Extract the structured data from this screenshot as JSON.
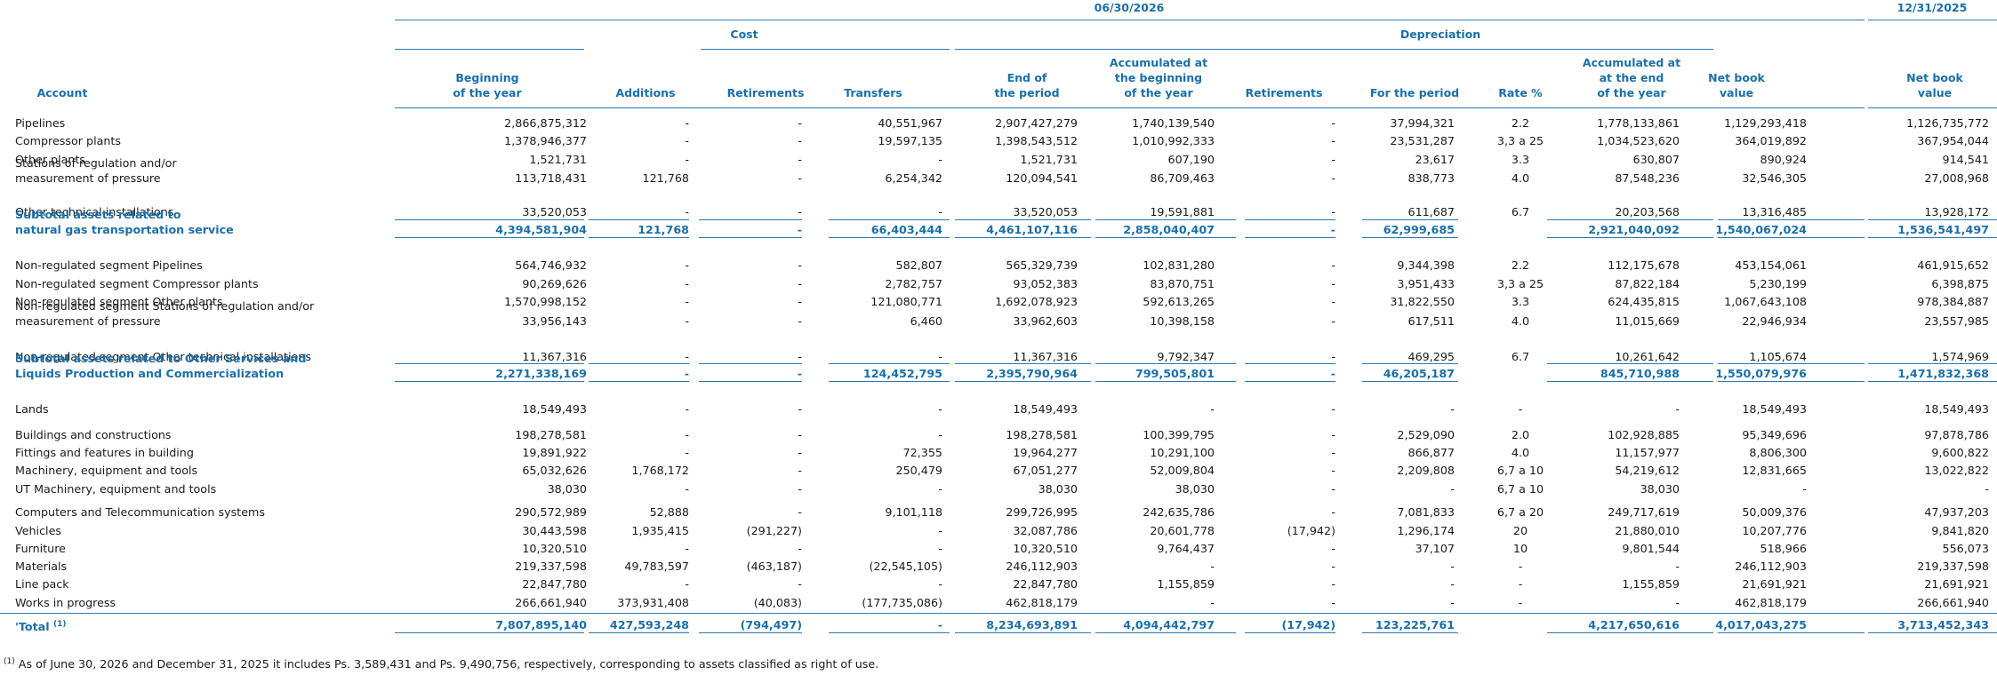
{
  "headers": {
    "date_current": "06/30/2026",
    "date_prior": "12/31/2025",
    "group_cost": "Cost",
    "group_depreciation": "Depreciation",
    "col_account": "Account",
    "cols": [
      [
        "Beginning",
        "of the year"
      ],
      [
        "Additions"
      ],
      [
        "Retirements"
      ],
      [
        "Transfers"
      ],
      [
        "End of",
        "the period"
      ],
      [
        "Accumulated at",
        "the beginning",
        "of the year"
      ],
      [
        "Retirements"
      ],
      [
        "For the period"
      ],
      [
        "Rate %"
      ],
      [
        "Accumulated at",
        "at the end",
        "of the year"
      ],
      [
        "Net book",
        "value"
      ],
      [
        "Net book",
        "value"
      ]
    ]
  },
  "rows": [
    {
      "label": [
        "Pipelines"
      ],
      "v": [
        "2,866,875,312",
        "-",
        "-",
        "40,551,967",
        "2,907,427,279",
        "1,740,139,540",
        "-",
        "37,994,321",
        "2.2",
        "1,778,133,861",
        "1,129,293,418",
        "1,126,735,772"
      ]
    },
    {
      "label": [
        "Compressor plants"
      ],
      "v": [
        "1,378,946,377",
        "-",
        "-",
        "19,597,135",
        "1,398,543,512",
        "1,010,992,333",
        "-",
        "23,531,287",
        "3,3 a 25",
        "1,034,523,620",
        "364,019,892",
        "367,954,044"
      ]
    },
    {
      "label": [
        "Other plants"
      ],
      "v": [
        "1,521,731",
        "-",
        "-",
        "-",
        "1,521,731",
        "607,190",
        "-",
        "23,617",
        "3.3",
        "630,807",
        "890,924",
        "914,541"
      ]
    },
    {
      "label": [
        "Stations of regulation and/or",
        "measurement of pressure"
      ],
      "v": [
        "113,718,431",
        "121,768",
        "-",
        "6,254,342",
        "120,094,541",
        "86,709,463",
        "-",
        "838,773",
        "4.0",
        "87,548,236",
        "32,546,305",
        "27,008,968"
      ]
    },
    {
      "label": [
        "Other technical installations"
      ],
      "v": [
        "33,520,053",
        "-",
        "-",
        "-",
        "33,520,053",
        "19,591,881",
        "-",
        "611,687",
        "6.7",
        "20,203,568",
        "13,316,485",
        "13,928,172"
      ]
    },
    {
      "sub": true,
      "label": [
        "Subtotal assets related to",
        "natural gas transportation service"
      ],
      "v": [
        "4,394,581,904",
        "121,768",
        "-",
        "66,403,444",
        "4,461,107,116",
        "2,858,040,407",
        "-",
        "62,999,685",
        "",
        "2,921,040,092",
        "1,540,067,024",
        "1,536,541,497"
      ]
    },
    {
      "label": [
        "Non-regulated segment Pipelines"
      ],
      "v": [
        "564,746,932",
        "-",
        "-",
        "582,807",
        "565,329,739",
        "102,831,280",
        "-",
        "9,344,398",
        "2.2",
        "112,175,678",
        "453,154,061",
        "461,915,652"
      ]
    },
    {
      "label": [
        "Non-regulated segment Compressor plants"
      ],
      "v": [
        "90,269,626",
        "-",
        "-",
        "2,782,757",
        "93,052,383",
        "83,870,751",
        "-",
        "3,951,433",
        "3,3 a 25",
        "87,822,184",
        "5,230,199",
        "6,398,875"
      ]
    },
    {
      "label": [
        "Non-regulated segment Other plants"
      ],
      "v": [
        "1,570,998,152",
        "-",
        "-",
        "121,080,771",
        "1,692,078,923",
        "592,613,265",
        "-",
        "31,822,550",
        "3.3",
        "624,435,815",
        "1,067,643,108",
        "978,384,887"
      ]
    },
    {
      "label": [
        "Non-regulated segment Stations of regulation and/or",
        "measurement of pressure"
      ],
      "v": [
        "33,956,143",
        "-",
        "-",
        "6,460",
        "33,962,603",
        "10,398,158",
        "-",
        "617,511",
        "4.0",
        "11,015,669",
        "22,946,934",
        "23,557,985"
      ]
    },
    {
      "label": [
        "Non-regulated segment Other technical installations"
      ],
      "v": [
        "11,367,316",
        "-",
        "-",
        "-",
        "11,367,316",
        "9,792,347",
        "-",
        "469,295",
        "6.7",
        "10,261,642",
        "1,105,674",
        "1,574,969"
      ]
    },
    {
      "sub": true,
      "label": [
        "Subtotal assets related to Other Services and",
        "Liquids Production and Commercialization"
      ],
      "v": [
        "2,271,338,169",
        "-",
        "-",
        "124,452,795",
        "2,395,790,964",
        "799,505,801",
        "-",
        "46,205,187",
        "",
        "845,710,988",
        "1,550,079,976",
        "1,471,832,368"
      ]
    },
    {
      "label": [
        "Lands"
      ],
      "v": [
        "18,549,493",
        "-",
        "-",
        "-",
        "18,549,493",
        "-",
        "-",
        "-",
        "-",
        "-",
        "18,549,493",
        "18,549,493"
      ]
    },
    {
      "label": [
        "Buildings and constructions"
      ],
      "v": [
        "198,278,581",
        "-",
        "-",
        "-",
        "198,278,581",
        "100,399,795",
        "-",
        "2,529,090",
        "2.0",
        "102,928,885",
        "95,349,696",
        "97,878,786"
      ]
    },
    {
      "label": [
        "Fittings and features in building"
      ],
      "v": [
        "19,891,922",
        "-",
        "-",
        "72,355",
        "19,964,277",
        "10,291,100",
        "-",
        "866,877",
        "4.0",
        "11,157,977",
        "8,806,300",
        "9,600,822"
      ]
    },
    {
      "label": [
        "Machinery, equipment and tools"
      ],
      "v": [
        "65,032,626",
        "1,768,172",
        "-",
        "250,479",
        "67,051,277",
        "52,009,804",
        "-",
        "2,209,808",
        "6,7 a 10",
        "54,219,612",
        "12,831,665",
        "13,022,822"
      ]
    },
    {
      "label": [
        "UT Machinery, equipment and tools"
      ],
      "v": [
        "38,030",
        "-",
        "-",
        "-",
        "38,030",
        "38,030",
        "-",
        "-",
        "6,7 a 10",
        "38,030",
        "-",
        "-"
      ]
    },
    {
      "label": [
        "Computers and Telecommunication systems"
      ],
      "v": [
        "290,572,989",
        "52,888",
        "-",
        "9,101,118",
        "299,726,995",
        "242,635,786",
        "-",
        "7,081,833",
        "6,7 a 20",
        "249,717,619",
        "50,009,376",
        "47,937,203"
      ]
    },
    {
      "label": [
        "Vehicles"
      ],
      "v": [
        "30,443,598",
        "1,935,415",
        "(291,227)",
        "-",
        "32,087,786",
        "20,601,778",
        "(17,942)",
        "1,296,174",
        "20",
        "21,880,010",
        "10,207,776",
        "9,841,820"
      ]
    },
    {
      "label": [
        "Furniture"
      ],
      "v": [
        "10,320,510",
        "-",
        "-",
        "-",
        "10,320,510",
        "9,764,437",
        "-",
        "37,107",
        "10",
        "9,801,544",
        "518,966",
        "556,073"
      ]
    },
    {
      "label": [
        "Materials"
      ],
      "v": [
        "219,337,598",
        "49,783,597",
        "(463,187)",
        "(22,545,105)",
        "246,112,903",
        "-",
        "-",
        "-",
        "-",
        "-",
        "246,112,903",
        "219,337,598"
      ]
    },
    {
      "label": [
        "Line pack"
      ],
      "v": [
        "22,847,780",
        "-",
        "-",
        "-",
        "22,847,780",
        "1,155,859",
        "-",
        "-",
        "-",
        "1,155,859",
        "21,691,921",
        "21,691,921"
      ]
    },
    {
      "label": [
        "Works in progress"
      ],
      "v": [
        "266,661,940",
        "373,931,408",
        "(40,083)",
        "(177,735,086)",
        "462,818,179",
        "-",
        "-",
        "-",
        "-",
        "-",
        "462,818,179",
        "266,661,940"
      ]
    },
    {
      "sub": true,
      "total": true,
      "label": [
        "'Total"
      ],
      "sup": "(1)",
      "v": [
        "7,807,895,140",
        "427,593,248",
        "(794,497)",
        "-",
        "8,234,693,891",
        "4,094,442,797",
        "(17,942)",
        "123,225,761",
        "",
        "4,217,650,616",
        "4,017,043,275",
        "3,713,452,343"
      ]
    }
  ],
  "footnote_mark": "(1)",
  "footnote": "As of June 30, 2026 and December 31, 2025 it includes Ps. 3,589,431 and Ps. 9,490,756, respectively, corresponding to assets classified as right of use."
}
